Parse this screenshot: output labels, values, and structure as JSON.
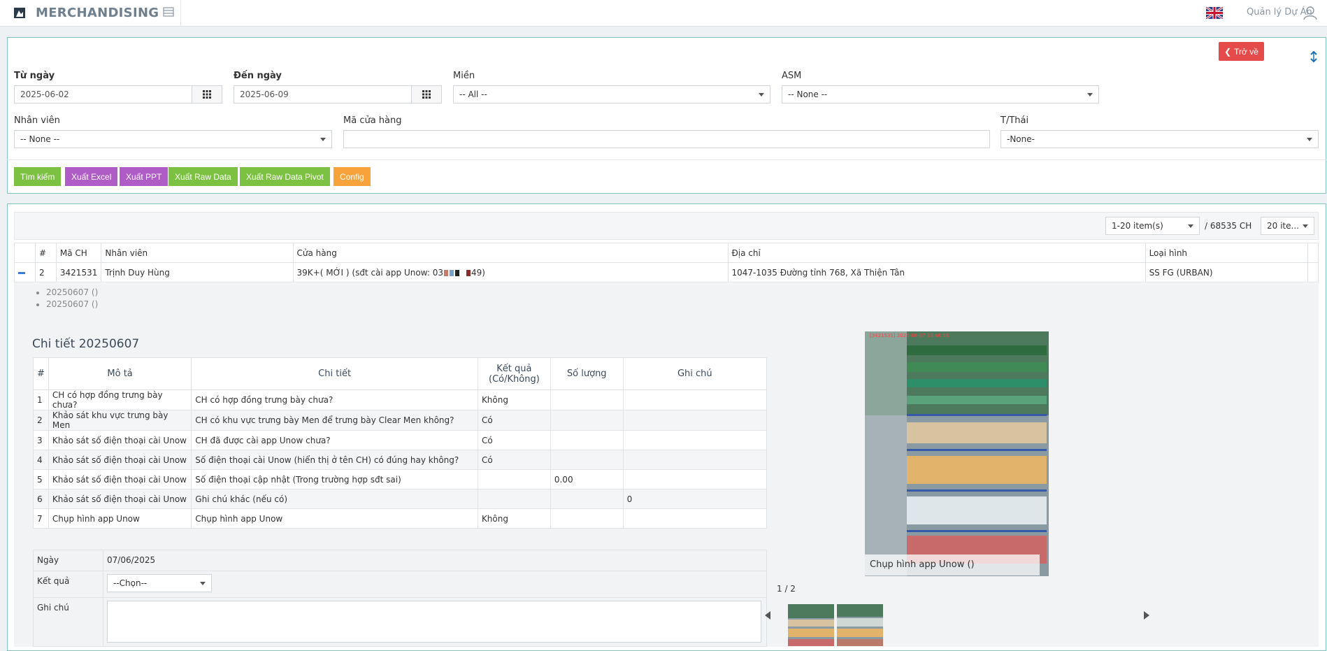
{
  "app": {
    "title": "MERCHANDISING",
    "user_label": "Quản lý Dự Án"
  },
  "filters": {
    "back_label": "Trở về",
    "from_date": {
      "label": "Từ ngày",
      "value": "2025-06-02"
    },
    "to_date": {
      "label": "Đến ngày",
      "value": "2025-06-09"
    },
    "region": {
      "label": "Miền",
      "value": "-- All --"
    },
    "asm": {
      "label": "ASM",
      "value": "-- None --"
    },
    "employee": {
      "label": "Nhân viên",
      "value": "-- None --"
    },
    "store_code": {
      "label": "Mã cửa hàng",
      "value": ""
    },
    "status": {
      "label": "T/Thái",
      "value": "-None-"
    },
    "buttons": {
      "search": "Tìm kiếm",
      "export_excel": "Xuất Excel",
      "export_ppt": "Xuất PPT",
      "export_raw": "Xuất Raw Data",
      "export_raw_pivot": "Xuất Raw Data Pivot",
      "config": "Config"
    }
  },
  "pager": {
    "range": "1-20 item(s)",
    "total": "/ 68535 CH",
    "page_size": "20 ite..."
  },
  "table": {
    "headers": {
      "index": "#",
      "code": "Mã CH",
      "employee": "Nhân viên",
      "store": "Cửa hàng",
      "address": "Địa chỉ",
      "type": "Loại hình"
    },
    "row": {
      "index": "2",
      "code": "3421531",
      "employee": "Trịnh Duy Hùng",
      "store_prefix": "39K+( MỚI ) (sđt cài app Unow: 03",
      "store_suffix": "49)",
      "address": "1047-1035 Đường tỉnh 768, Xã Thiện Tân",
      "type": "SS FG (URBAN)"
    }
  },
  "visits": [
    "20250607 ()",
    "20250607 ()"
  ],
  "detail": {
    "title": "Chi tiết 20250607",
    "headers": {
      "index": "#",
      "desc": "Mô tả",
      "detail": "Chi tiết",
      "result": "Kết quả (Có/Không)",
      "qty": "Số lượng",
      "note": "Ghi chú"
    },
    "rows": [
      {
        "index": "1",
        "desc": "CH có hợp đồng trưng bày chưa?",
        "detail": "CH có hợp đồng trưng bày chưa?",
        "result": "Không",
        "qty": "",
        "note": ""
      },
      {
        "index": "2",
        "desc": "Khảo sát khu vực trưng bày Men",
        "detail": "CH có khu vực trưng bày Men để trưng bày Clear Men không?",
        "result": "Có",
        "qty": "",
        "note": ""
      },
      {
        "index": "3",
        "desc": "Khảo sát số điện thoại cài Unow",
        "detail": "CH đã được cài app Unow chưa?",
        "result": "Có",
        "qty": "",
        "note": ""
      },
      {
        "index": "4",
        "desc": "Khảo sát số điện thoại cài Unow",
        "detail": "Số điện thoại cài Unow (hiển thị ở tên CH) có đúng hay không?",
        "result": "Có",
        "qty": "",
        "note": ""
      },
      {
        "index": "5",
        "desc": "Khảo sát số điện thoại cài Unow",
        "detail": "Số điện thoại cập nhật (Trong trường hợp sđt sai)",
        "result": "",
        "qty": "0.00",
        "note": ""
      },
      {
        "index": "6",
        "desc": "Khảo sát số điện thoại cài Unow",
        "detail": "Ghi chú khác (nếu có)",
        "result": "",
        "qty": "",
        "note": "0"
      },
      {
        "index": "7",
        "desc": "Chụp hình app Unow",
        "detail": "Chụp hình app Unow",
        "result": "Không",
        "qty": "",
        "note": ""
      }
    ]
  },
  "form": {
    "date_label": "Ngày",
    "date_value": "07/06/2025",
    "result_label": "Kết quả",
    "result_value": "--Chọn--",
    "note_label": "Ghi chú"
  },
  "photo": {
    "stamp": "[3421531] 2025-06-07 13:46:56",
    "caption": "Chụp hình app Unow ()",
    "counter": "1 / 2"
  },
  "colors": {
    "accent_green": "#7cc142",
    "accent_purple": "#b05cc6",
    "accent_orange": "#f7a23b",
    "danger": "#e54b4b",
    "panel_border": "#7fc3c3"
  }
}
